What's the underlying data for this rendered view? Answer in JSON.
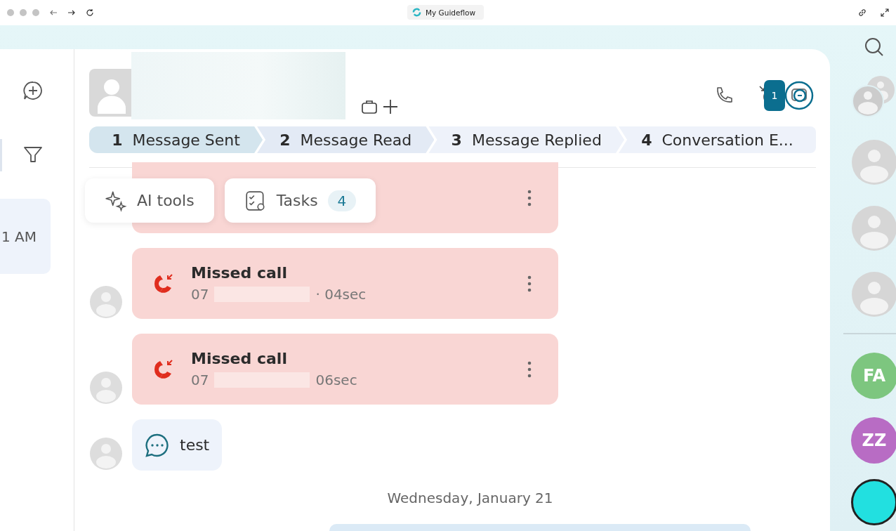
{
  "browser": {
    "title": "My Guideflow"
  },
  "left_panel": {
    "conversation_time": "1 AM"
  },
  "header": {
    "badge": "1"
  },
  "stages": [
    {
      "number": "1",
      "label": "Message Sent",
      "selected": true
    },
    {
      "number": "2",
      "label": "Message Read",
      "selected": false
    },
    {
      "number": "3",
      "label": "Message Replied",
      "selected": false
    },
    {
      "number": "4",
      "label": "Conversation E...",
      "selected": false
    }
  ],
  "popups": [
    {
      "kind": "ai",
      "label": "AI tools"
    },
    {
      "kind": "tasks",
      "label": "Tasks",
      "count": "4"
    }
  ],
  "messages": [
    {
      "kind": "hidden"
    },
    {
      "kind": "missed_call",
      "title": "Missed call",
      "prefix": "07",
      "duration": "· 04sec"
    },
    {
      "kind": "missed_call",
      "title": "Missed call",
      "prefix": "07",
      "duration": "06sec"
    },
    {
      "kind": "text",
      "text": "test"
    }
  ],
  "date_divider": "Wednesday, January 21",
  "contacts": [
    {
      "kind": "group"
    },
    {
      "kind": "blank"
    },
    {
      "kind": "blank"
    },
    {
      "kind": "blank"
    },
    {
      "kind": "divider"
    },
    {
      "kind": "initials",
      "initials": "FA",
      "color": "#7dc67f"
    },
    {
      "kind": "initials",
      "initials": "ZZ",
      "color": "#b86cc4"
    },
    {
      "kind": "partial",
      "color": "#22e0e0"
    }
  ]
}
